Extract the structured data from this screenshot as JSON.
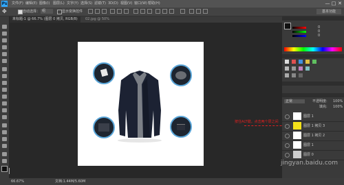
{
  "app": {
    "logo": "Ps"
  },
  "menu": [
    "文件(F)",
    "编辑(E)",
    "图像(I)",
    "图层(L)",
    "文字(Y)",
    "选择(S)",
    "滤镜(T)",
    "3D(D)",
    "视图(V)",
    "窗口(W)",
    "帮助(H)"
  ],
  "window_controls": {
    "minimize": "—",
    "maximize": "□",
    "close": "✕"
  },
  "options": {
    "auto_select_label": "自动选择：",
    "auto_select_value": "组",
    "transform_label": "显示变换控件",
    "workspace": "基本功能"
  },
  "document": {
    "tab_label": "未标题-1 @ 66.7% (图层 0 拷贝, RGB/8)",
    "tab2_label": "02.jpg @ 50%"
  },
  "annotation": {
    "text": "按住ALT键，点击两个层之间"
  },
  "status": {
    "zoom": "66.67%",
    "doc_info": "文档:1.44M/5.60M"
  },
  "color_panel": {
    "values": [
      "0",
      "0",
      "0"
    ]
  },
  "layers": {
    "blend_mode": "正常",
    "opacity_label": "不透明度:",
    "opacity_value": "100%",
    "fill_label": "填充:",
    "fill_value": "100%",
    "items": [
      {
        "name": "图层 1"
      },
      {
        "name": "图层 1 拷贝 3"
      },
      {
        "name": "图层 1 拷贝 2"
      },
      {
        "name": "图层 1"
      },
      {
        "name": "图层 0"
      }
    ]
  },
  "watermark": "jingyan.baidu.com",
  "colors": {
    "accent": "#31a8ff",
    "annotation": "#e02020",
    "circle_border": "#5aa6d9"
  }
}
